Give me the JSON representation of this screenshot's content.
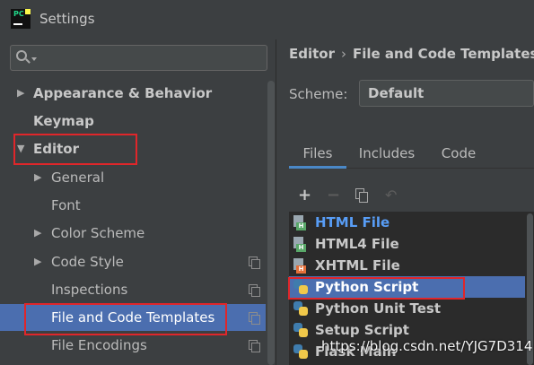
{
  "window": {
    "title": "Settings",
    "app_icon": "pycharm-logo"
  },
  "search": {
    "placeholder": "",
    "value": ""
  },
  "sidebar": {
    "items": [
      {
        "label": "Appearance & Behavior",
        "expandable": true,
        "expanded": false,
        "bold": true
      },
      {
        "label": "Keymap",
        "expandable": false,
        "bold": true
      },
      {
        "label": "Editor",
        "expandable": true,
        "expanded": true,
        "bold": true,
        "highlighted": true
      },
      {
        "label": "General",
        "expandable": true,
        "expanded": false
      },
      {
        "label": "Font",
        "expandable": false
      },
      {
        "label": "Color Scheme",
        "expandable": true,
        "expanded": false
      },
      {
        "label": "Code Style",
        "expandable": true,
        "expanded": false,
        "has_copy_icon": true
      },
      {
        "label": "Inspections",
        "expandable": false,
        "has_copy_icon": true
      },
      {
        "label": "File and Code Templates",
        "expandable": false,
        "has_copy_icon": true,
        "selected": true,
        "highlighted": true
      },
      {
        "label": "File Encodings",
        "expandable": false,
        "has_copy_icon": true
      }
    ]
  },
  "breadcrumb": {
    "parent": "Editor",
    "separator": "›",
    "current": "File and Code Templates"
  },
  "scheme": {
    "label": "Scheme:",
    "value": "Default"
  },
  "tabs": [
    {
      "label": "Files",
      "active": true
    },
    {
      "label": "Includes",
      "active": false
    },
    {
      "label": "Code",
      "active": false
    }
  ],
  "toolbar": {
    "add_icon": "plus-icon",
    "remove_icon": "minus-icon",
    "copy_icon": "copy-icon",
    "reset_icon": "reset-icon"
  },
  "templates": [
    {
      "name": "HTML File",
      "icon": "html-file-icon",
      "color": "#589df6"
    },
    {
      "name": "HTML4 File",
      "icon": "html-file-icon"
    },
    {
      "name": "XHTML File",
      "icon": "xhtml-file-icon"
    },
    {
      "name": "Python Script",
      "icon": "python-icon",
      "selected": true,
      "highlighted": true
    },
    {
      "name": "Python Unit Test",
      "icon": "python-icon"
    },
    {
      "name": "Setup Script",
      "icon": "python-icon"
    },
    {
      "name": "Flask Main",
      "icon": "python-icon"
    }
  ],
  "watermark": "https://blog.csdn.net/YJG7D314",
  "colors": {
    "selection": "#4b6eaf",
    "highlight_box": "#e0262a",
    "link_blue": "#589df6",
    "tab_underline": "#4a88c7"
  }
}
